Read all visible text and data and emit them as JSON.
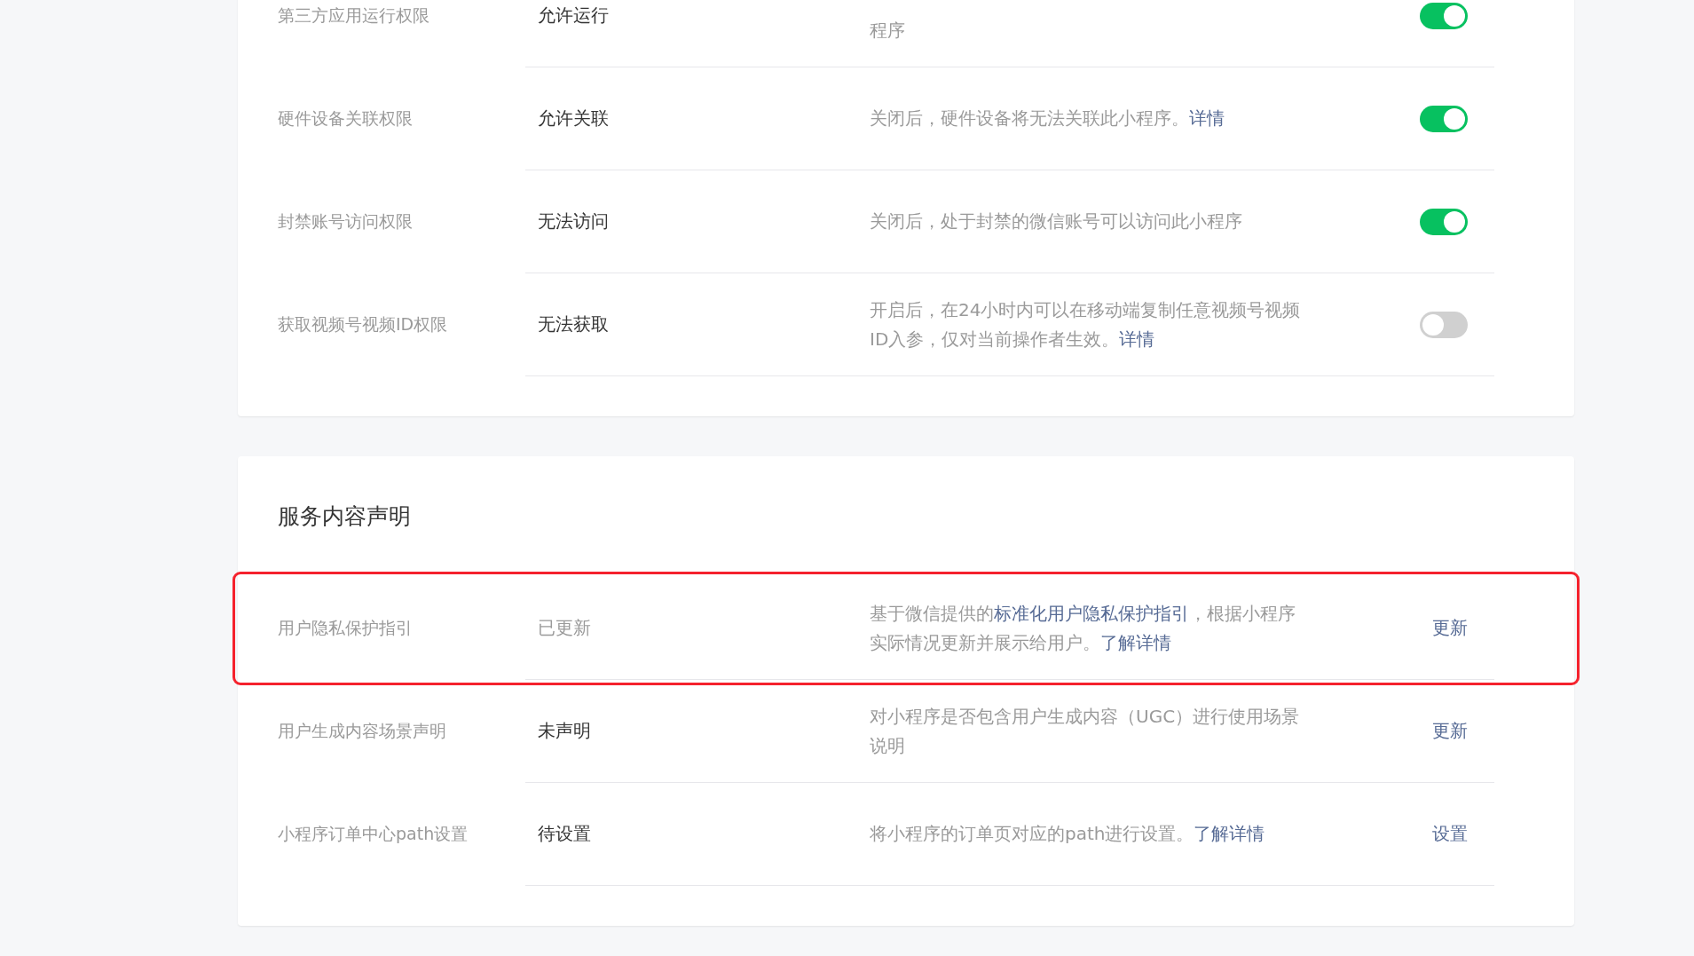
{
  "sections": [
    {
      "rows": [
        {
          "label": "第三方应用运行权限",
          "value": "允许运行",
          "value_muted": false,
          "highlighted": false,
          "clipped_top": true,
          "description": [
            {
              "text": "程序",
              "link": false
            }
          ],
          "action": {
            "kind": "toggle",
            "on": true
          }
        },
        {
          "label": "硬件设备关联权限",
          "value": "允许关联",
          "value_muted": false,
          "highlighted": false,
          "clipped_top": false,
          "description": [
            {
              "text": "关闭后，硬件设备将无法关联此小程序。",
              "link": false
            },
            {
              "text": "详情",
              "link": true
            }
          ],
          "action": {
            "kind": "toggle",
            "on": true
          }
        },
        {
          "label": "封禁账号访问权限",
          "value": "无法访问",
          "value_muted": false,
          "highlighted": false,
          "clipped_top": false,
          "description": [
            {
              "text": "关闭后，处于封禁的微信账号可以访问此小程序",
              "link": false
            }
          ],
          "action": {
            "kind": "toggle",
            "on": true
          }
        },
        {
          "label": "获取视频号视频ID权限",
          "value": "无法获取",
          "value_muted": false,
          "highlighted": false,
          "clipped_top": false,
          "description": [
            {
              "text": "开启后，在24小时内可以在移动端复制任意视频号视频ID入参，仅对当前操作者生效。",
              "link": false
            },
            {
              "text": "详情",
              "link": true
            }
          ],
          "action": {
            "kind": "toggle",
            "on": false
          }
        }
      ]
    },
    {
      "title": "服务内容声明",
      "rows": [
        {
          "label": "用户隐私保护指引",
          "value": "已更新",
          "value_muted": true,
          "highlighted": true,
          "clipped_top": false,
          "description": [
            {
              "text": "基于微信提供的",
              "link": false
            },
            {
              "text": "标准化用户隐私保护指引",
              "link": true
            },
            {
              "text": "，根据小程序实际情况更新并展示给用户。",
              "link": false
            },
            {
              "text": "了解详情",
              "link": true
            }
          ],
          "action": {
            "kind": "link",
            "text": "更新"
          }
        },
        {
          "label": "用户生成内容场景声明",
          "value": "未声明",
          "value_muted": false,
          "highlighted": false,
          "clipped_top": false,
          "description": [
            {
              "text": "对小程序是否包含用户生成内容（UGC）进行使用场景说明",
              "link": false
            }
          ],
          "action": {
            "kind": "link",
            "text": "更新"
          }
        },
        {
          "label": "小程序订单中心path设置",
          "value": "待设置",
          "value_muted": false,
          "highlighted": false,
          "clipped_top": false,
          "description": [
            {
              "text": "将小程序的订单页对应的path进行设置。",
              "link": false
            },
            {
              "text": "了解详情",
              "link": true
            }
          ],
          "action": {
            "kind": "link",
            "text": "设置"
          }
        }
      ]
    }
  ]
}
